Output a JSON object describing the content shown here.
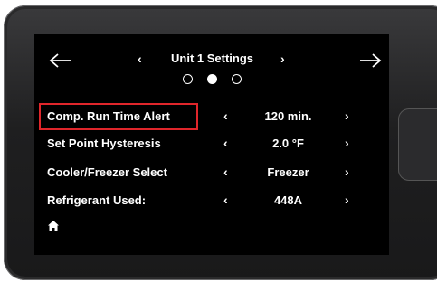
{
  "header": {
    "title": "Unit 1 Settings",
    "back_arrow": "←",
    "forward_arrow": "→",
    "prev_chevron": "‹",
    "next_chevron": "›"
  },
  "pagination": {
    "pages": 3,
    "active_index": 1
  },
  "settings": [
    {
      "label": "Comp. Run Time Alert",
      "value": "120 min.",
      "highlighted": true
    },
    {
      "label": "Set Point Hysteresis",
      "value": "2.0 °F",
      "highlighted": false
    },
    {
      "label": "Cooler/Freezer Select",
      "value": "Freezer",
      "highlighted": false
    },
    {
      "label": "Refrigerant Used:",
      "value": "448A",
      "highlighted": false
    }
  ],
  "chevrons": {
    "left": "‹",
    "right": "›"
  },
  "icons": {
    "home": "home-icon",
    "back": "arrow-left-icon",
    "forward": "arrow-right-icon"
  },
  "colors": {
    "screen_bg": "#000000",
    "text": "#ffffff",
    "highlight": "#e0262b",
    "bezel": "#1f1f20"
  }
}
